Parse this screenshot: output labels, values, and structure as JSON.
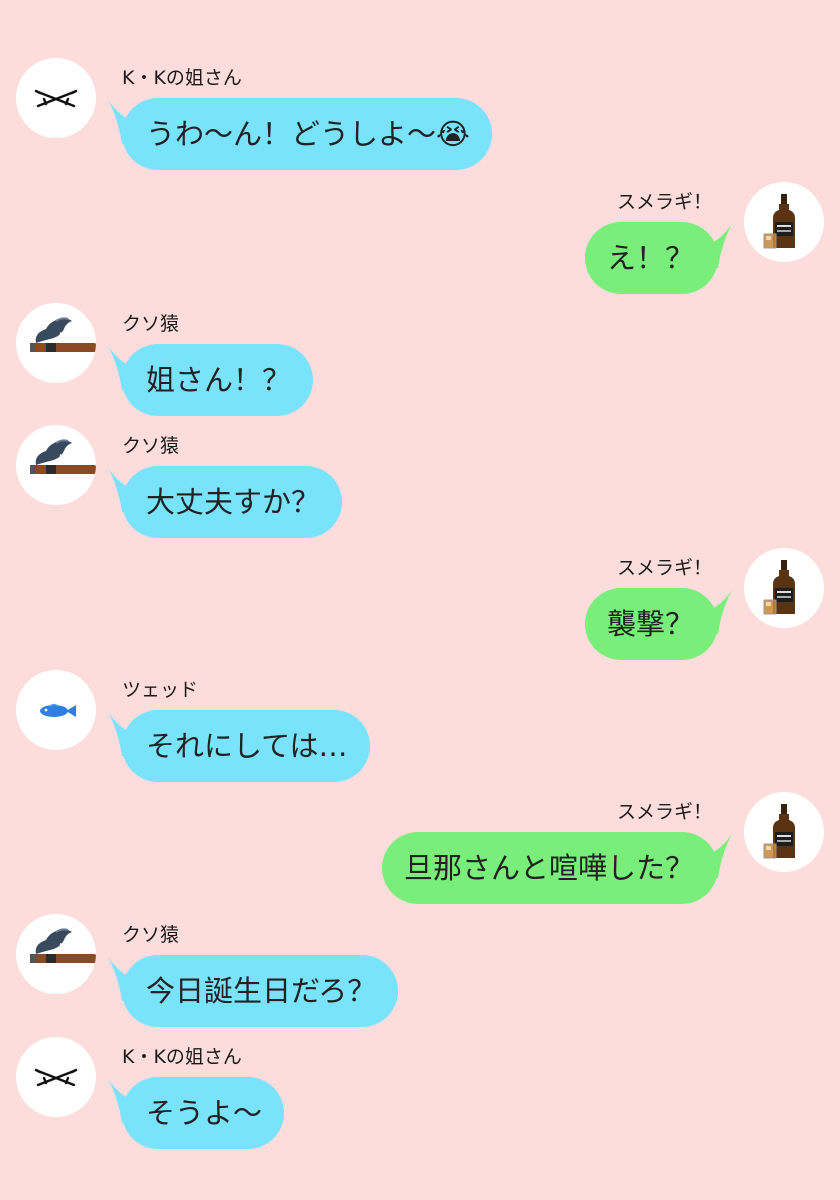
{
  "colors": {
    "background": "#fddcdc",
    "left_bubble": "#78e3fb",
    "right_bubble": "#79ee7a"
  },
  "messages": [
    {
      "sender": "K・Kの姐さん",
      "text": "うわ〜ん！どうしよ〜😭",
      "side": "left",
      "avatar": "crossed-rifles-icon"
    },
    {
      "sender": "スメラギ！",
      "text": "え！？",
      "side": "right",
      "avatar": "whiskey-bottle-icon"
    },
    {
      "sender": "クソ猿",
      "text": "姐さん！？",
      "side": "left",
      "avatar": "cigar-icon"
    },
    {
      "sender": "クソ猿",
      "text": "大丈夫すか？",
      "side": "left",
      "avatar": "cigar-icon"
    },
    {
      "sender": "スメラギ！",
      "text": "襲撃？",
      "side": "right",
      "avatar": "whiskey-bottle-icon"
    },
    {
      "sender": "ツェッド",
      "text": "それにしては…",
      "side": "left",
      "avatar": "blue-fish-icon"
    },
    {
      "sender": "スメラギ！",
      "text": "旦那さんと喧嘩した？",
      "side": "right",
      "avatar": "whiskey-bottle-icon"
    },
    {
      "sender": "クソ猿",
      "text": "今日誕生日だろ？",
      "side": "left",
      "avatar": "cigar-icon"
    },
    {
      "sender": "K・Kの姐さん",
      "text": "そうよ〜",
      "side": "left",
      "avatar": "crossed-rifles-icon"
    }
  ]
}
